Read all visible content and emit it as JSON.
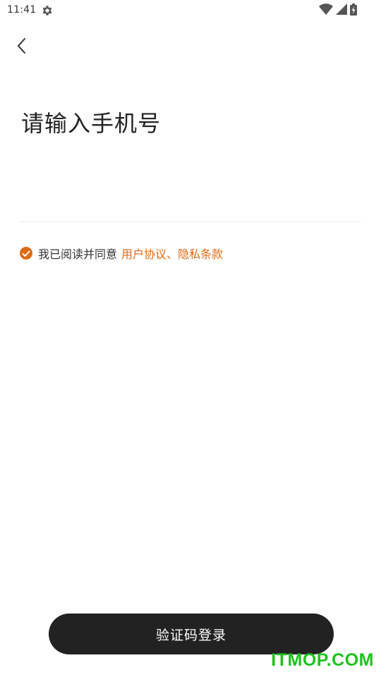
{
  "status_bar": {
    "time": "11:41",
    "icons": [
      "settings-gear-icon",
      "wifi-icon",
      "cellular-signal-icon",
      "battery-charging-icon"
    ]
  },
  "header": {
    "back_icon": "chevron-left-icon"
  },
  "main": {
    "title": "请输入手机号",
    "phone_input": {
      "value": "",
      "placeholder": ""
    },
    "agreement": {
      "checked": true,
      "prefix": "我已阅读并同意",
      "links": "用户协议、隐私条款"
    }
  },
  "footer": {
    "login_button": "验证码登录"
  },
  "watermark": "ITMOP.COM",
  "colors": {
    "accent": "#e06a12",
    "button_bg": "#222222",
    "button_text": "#ffffff",
    "watermark": "#1ec21e"
  }
}
